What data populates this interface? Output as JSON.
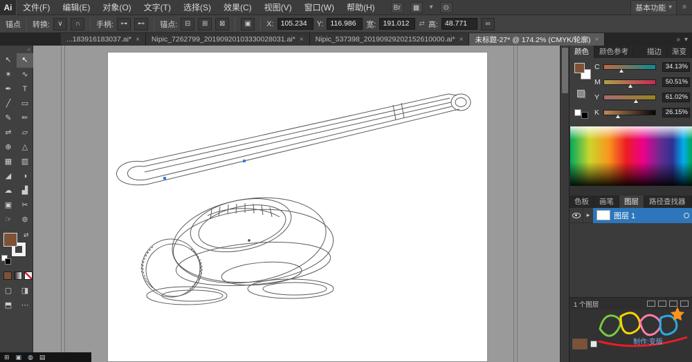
{
  "app": {
    "logo": "Ai",
    "workspace": "基本功能"
  },
  "menu": {
    "items": [
      "文件(F)",
      "编辑(E)",
      "对象(O)",
      "文字(T)",
      "选择(S)",
      "效果(C)",
      "视图(V)",
      "窗口(W)",
      "帮助(H)"
    ]
  },
  "control": {
    "selection_label": "锚点",
    "convert_label": "转换:",
    "handles_label": "手柄:",
    "anchors_label": "锚点:",
    "x_label": "X:",
    "x_value": "105.234",
    "y_label": "Y:",
    "y_value": "116.986",
    "width_label": "宽:",
    "width_value": "191.012",
    "height_label": "高:",
    "height_value": "48.771"
  },
  "tabs": [
    {
      "title": "...183916183037.ai*"
    },
    {
      "title": "Nipic_7262799_20190920103330028031.ai*"
    },
    {
      "title": "Nipic_537398_20190929202152610000.ai*"
    },
    {
      "title": "未标题-27* @ 174.2% (CMYK/轮廓)"
    }
  ],
  "tools": [
    {
      "name": "selection",
      "glyph": "↖"
    },
    {
      "name": "direct-selection",
      "glyph": "↖"
    },
    {
      "name": "magic-wand",
      "glyph": "✶"
    },
    {
      "name": "lasso",
      "glyph": "∿"
    },
    {
      "name": "pen",
      "glyph": "✒"
    },
    {
      "name": "type",
      "glyph": "T"
    },
    {
      "name": "line-segment",
      "glyph": "╱"
    },
    {
      "name": "rectangle",
      "glyph": "▭"
    },
    {
      "name": "paintbrush",
      "glyph": "✎"
    },
    {
      "name": "pencil",
      "glyph": "✏"
    },
    {
      "name": "width",
      "glyph": "⇌"
    },
    {
      "name": "free-transform",
      "glyph": "▱"
    },
    {
      "name": "shape-builder",
      "glyph": "⊕"
    },
    {
      "name": "perspective-grid",
      "glyph": "△"
    },
    {
      "name": "mesh",
      "glyph": "▦"
    },
    {
      "name": "gradient",
      "glyph": "▥"
    },
    {
      "name": "eyedropper",
      "glyph": "◢"
    },
    {
      "name": "blend",
      "glyph": "◑"
    },
    {
      "name": "symbol-sprayer",
      "glyph": "☁"
    },
    {
      "name": "column-graph",
      "glyph": "▟"
    },
    {
      "name": "artboard",
      "glyph": "▣"
    },
    {
      "name": "slice",
      "glyph": "✂"
    },
    {
      "name": "hand",
      "glyph": "☞"
    },
    {
      "name": "zoom",
      "glyph": "⊚"
    }
  ],
  "color_panel": {
    "tabs": [
      "颜色",
      "颜色参考"
    ],
    "group2_tabs": [
      "描边",
      "渐变"
    ],
    "channels": [
      {
        "label": "C",
        "value": "34.13%"
      },
      {
        "label": "M",
        "value": "50.51%"
      },
      {
        "label": "Y",
        "value": "61.02%"
      },
      {
        "label": "K",
        "value": "26.15%"
      }
    ]
  },
  "lower_panel": {
    "tabs": [
      "色板",
      "画笔",
      "图层",
      "路径查找器"
    ],
    "layers": [
      {
        "name": "图层 1"
      }
    ],
    "footer": "1 个图层"
  },
  "watermark": {
    "credit": "制作:变版"
  },
  "icons": {
    "close": "×",
    "chevron_down": "▾",
    "chevron_right": "▸",
    "overflow": "»",
    "menu": "≡",
    "collapse": "«",
    "swap": "⇄",
    "link": "∞",
    "convert_corner": "∨",
    "convert_smooth": "∩",
    "handles_show": "⊶",
    "handles_hide": "⊷",
    "anchor_remove": "⊟",
    "anchor_add": "⊞",
    "anchor_cut": "⊠",
    "isolate": "▣",
    "bridge": "Br",
    "arrange": "▦",
    "search": "⊙",
    "draw_normal": "▢",
    "draw_behind": "◨",
    "draw_inside": "⬒",
    "screen_mode": "⋯",
    "start": "⊞",
    "taskbar_a": "▣",
    "taskbar_b": "◍",
    "taskbar_c": "▤"
  },
  "colors": {
    "accent_blue": "#2d76bb",
    "fill_brown": "#7d5236",
    "canvas_gray": "#9a9a9a"
  }
}
